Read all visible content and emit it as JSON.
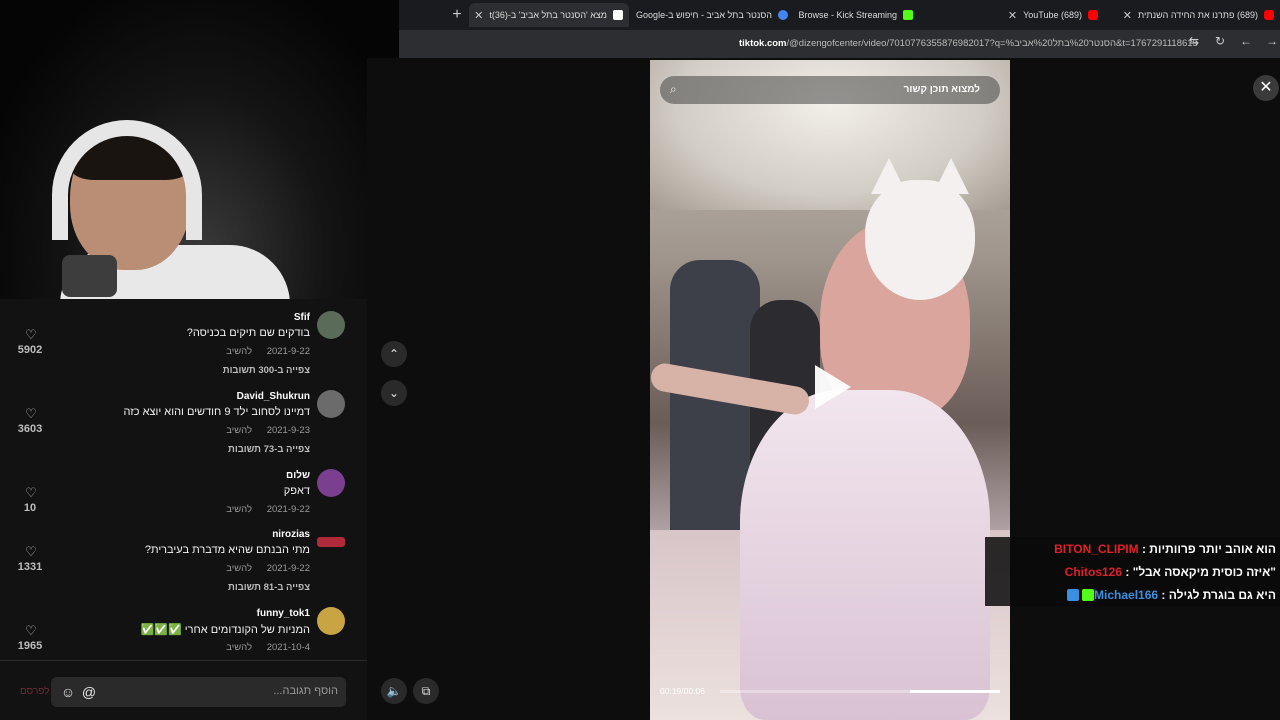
{
  "browser": {
    "new_tab": "+",
    "tabs": [
      {
        "title": "מצא 'הסנטר בתל אביב' ב-t(36)",
        "active": true,
        "favicon_color": "#ffffff"
      },
      {
        "title": "הסנטר בתל אביב - חיפוש ב-Google",
        "active": false,
        "favicon_color": "#4285f4"
      },
      {
        "title": "Browse - Kick Streaming",
        "active": false,
        "favicon_color": "#53fc18"
      },
      {
        "title": "(689) YouTube",
        "active": false,
        "favicon_color": "#ff0000"
      },
      {
        "title": "(689) פתרנו את החידה השנתית",
        "active": false,
        "favicon_color": "#ff0000"
      }
    ],
    "url_host": "tiktok.com",
    "url_rest": "/@dizengofcenter/video/7010776355876982017?q=%הסנטר%20בתל%20אביב&t=1767291118615"
  },
  "comments": [
    {
      "name": "Sfif",
      "text": "בודקים שם תיקים בכניסה?",
      "date": "2021-9-22",
      "reply": "להשיב",
      "views": "צפייה ב-300 תשובות",
      "likes": "5902",
      "avatar_color": "#5b6b5a"
    },
    {
      "name": "David_Shukrun",
      "text": "דמיינו לסחוב ילד 9 חודשים והוא יוצא כזה",
      "date": "2021-9-23",
      "reply": "להשיב",
      "views": "צפייה ב-73 תשובות",
      "likes": "3603",
      "avatar_color": "#6b6b6b"
    },
    {
      "name": "שלום",
      "text": "דאפק",
      "date": "2021-9-22",
      "reply": "להשיב",
      "views": "",
      "likes": "10",
      "avatar_color": "#7a3f8f"
    },
    {
      "name": "nirozias",
      "text": "מתי הבנתם שהיא מדברת בעיברית?",
      "date": "2021-9-22",
      "reply": "להשיב",
      "views": "צפייה ב-81 תשובות",
      "likes": "1331",
      "avatar_color": "#b02a3a"
    },
    {
      "name": "funny_tok1",
      "text": "המניות של הקונדומים אחרי ✅✅✅",
      "date": "2021-10-4",
      "reply": "להשיב",
      "views": "",
      "likes": "1965",
      "avatar_color": "#c9a443"
    }
  ],
  "composer": {
    "placeholder": "הוסף תגובה...",
    "post_label": "לפרסם"
  },
  "video": {
    "search_text": "למצוא תוכן קשור",
    "time": "00:19/00:06",
    "progress": 0.68
  },
  "chat": [
    {
      "user": "BITON_CLIPIM",
      "user_color": "#e0202a",
      "msg": "הוא אוהב יותר פרוותיות :"
    },
    {
      "user": "Chitos126",
      "user_color": "#e0202a",
      "msg": "\"איזה כוסית מיקאסה אבל\" :"
    },
    {
      "user": "Michael166",
      "user_color": "#3a8fe0",
      "msg": "היא גם בוגרת לגילה :"
    }
  ]
}
